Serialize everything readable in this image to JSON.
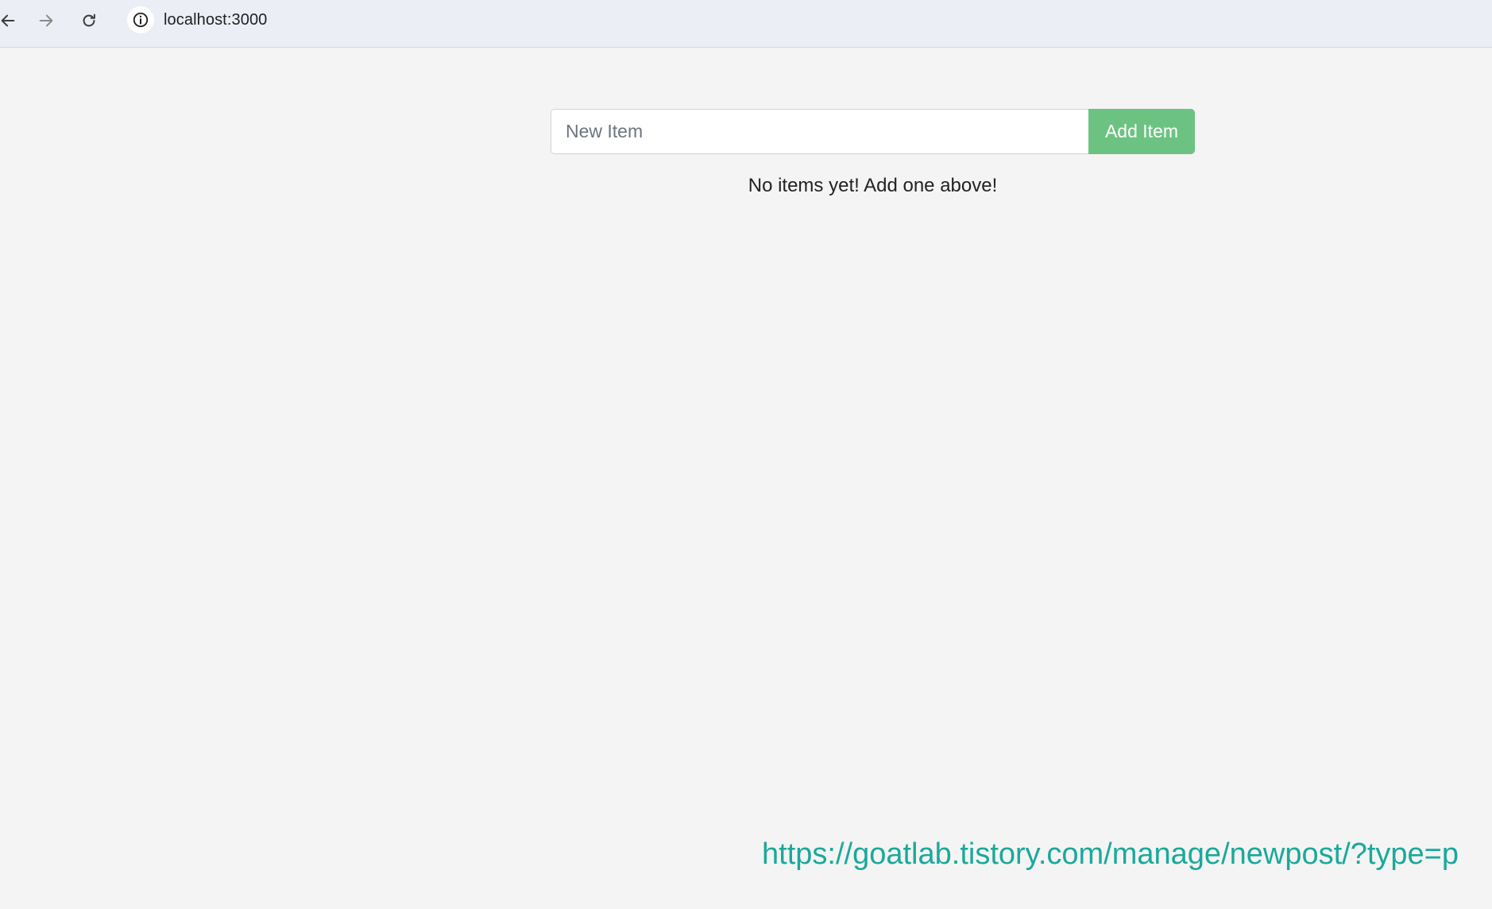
{
  "browser": {
    "url": "localhost:3000",
    "icons": {
      "back": "back-arrow-icon",
      "forward": "forward-arrow-icon",
      "reload": "reload-icon",
      "site_info": "info-icon"
    }
  },
  "app": {
    "input_placeholder": "New Item",
    "input_value": "",
    "add_button_label": "Add Item",
    "empty_message": "No items yet! Add one above!"
  },
  "overlay": {
    "watermark_text": "https://goatlab.tistory.com/manage/newpost/?type=p"
  },
  "colors": {
    "page_background": "#f4f4f4",
    "toolbar_background": "#ebeef5",
    "add_button": "#6cc381",
    "watermark": "#1aa99a"
  }
}
